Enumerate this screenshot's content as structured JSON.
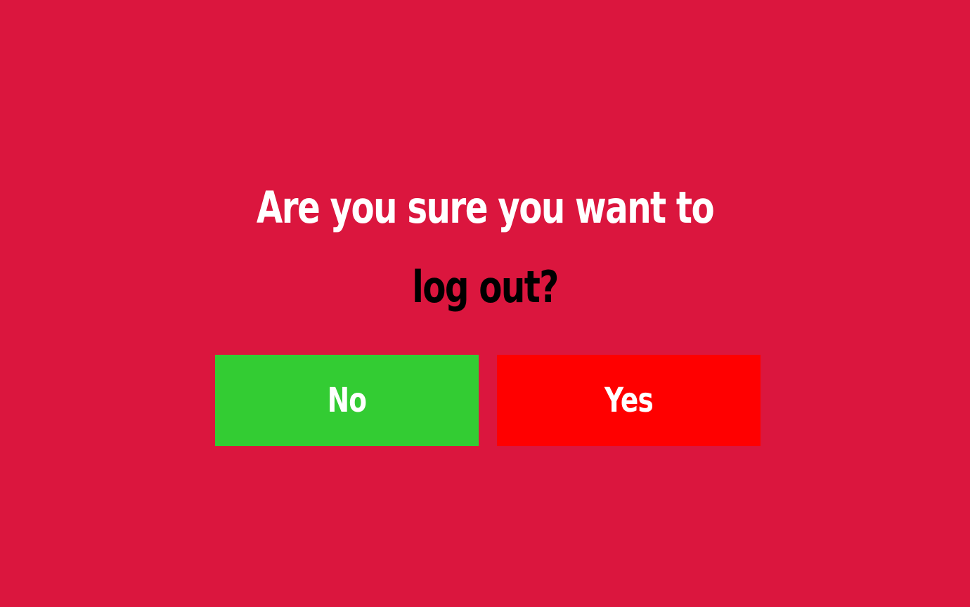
{
  "dialog": {
    "question_line_1": "Are you sure you want to",
    "question_line_2": "log out?",
    "no_label": "No",
    "yes_label": "Yes"
  },
  "colors": {
    "background": "#DB163E",
    "question_line_1_text": "#FFFFFF",
    "question_line_2_text": "#000000",
    "no_button": "#33CC33",
    "yes_button": "#FF0000",
    "button_text": "#FFFFFF"
  }
}
